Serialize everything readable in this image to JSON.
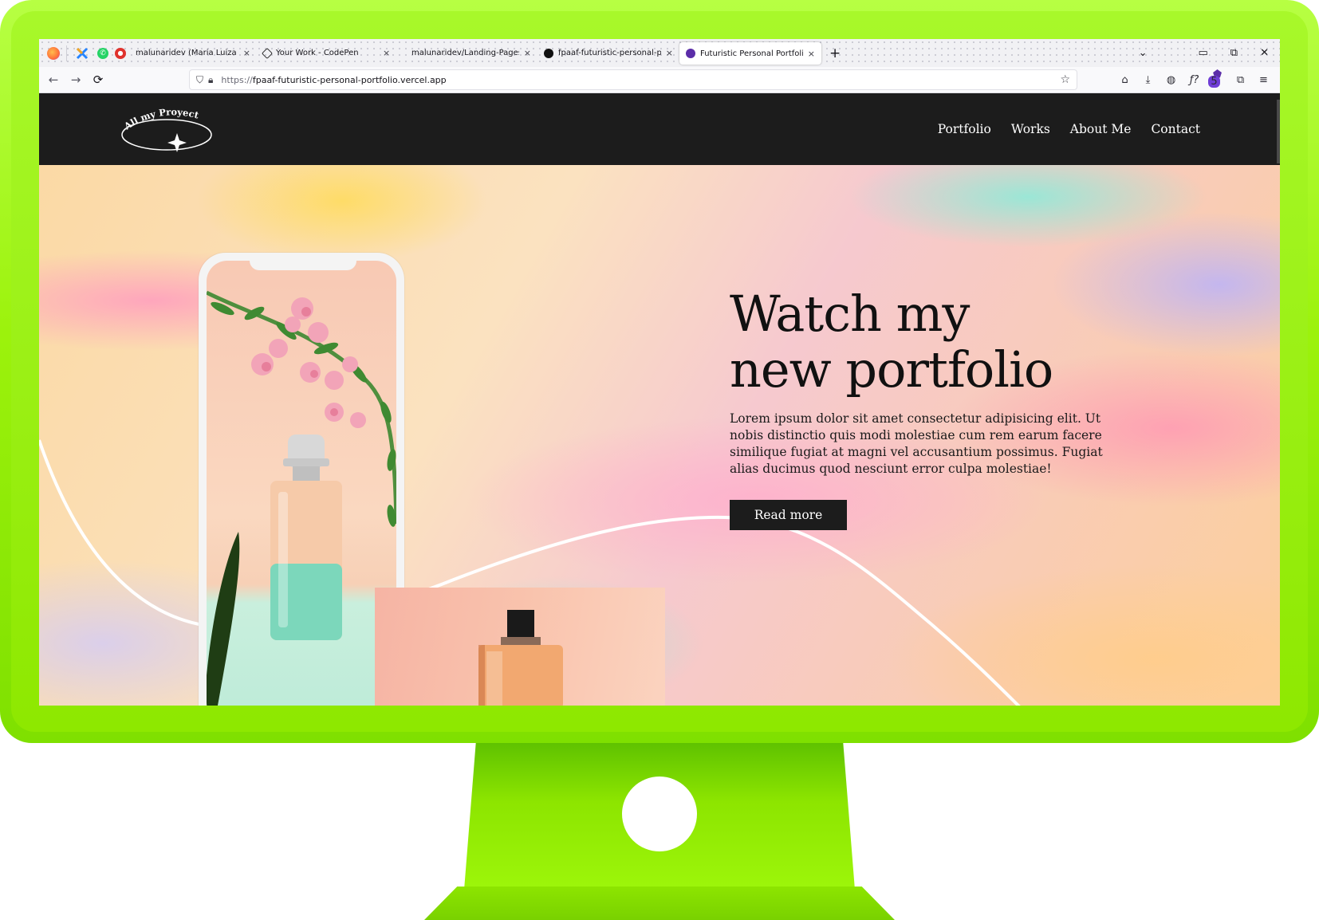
{
  "browser": {
    "pinned_tabs": [
      {
        "icon": "firefox-icon"
      },
      {
        "icon": "confluence-icon"
      },
      {
        "icon": "whatsapp-icon"
      },
      {
        "icon": "notification-icon"
      }
    ],
    "tabs": [
      {
        "title": "malunaridev (Maria Luiza Pinto)",
        "close": "×",
        "active": false,
        "favicon_color": "#f6f6f6"
      },
      {
        "title": "Your Work - CodePen",
        "close": "×",
        "active": false,
        "favicon_color": "#2b2b2b"
      },
      {
        "title": "malunaridev/Landing-Pages-A",
        "close": "×",
        "active": false,
        "favicon_color": "#f6f6f6"
      },
      {
        "title": "fpaaf-futuristic-personal-portfo",
        "close": "×",
        "active": false,
        "favicon_color": "#111111"
      },
      {
        "title": "Futuristic Personal Portfolio",
        "close": "×",
        "active": true,
        "favicon_color": "#5b2da8"
      }
    ],
    "new_tab": "+",
    "tab_list": "⌄",
    "window_controls": {
      "minimize": "▭",
      "restore": "⧉",
      "close": "✕"
    },
    "nav": {
      "back": "←",
      "forward": "→",
      "reload": "⟳"
    },
    "url_prefix": "https://",
    "url": "fpaaf-futuristic-personal-portfolio.vercel.app",
    "bookmark": "☆",
    "toolbar": {
      "home": "⌂",
      "downloads": "⤓",
      "account": "◍",
      "fx": "ƒ?",
      "extension_badge": "5",
      "extensions": "⧉",
      "menu": "≡"
    }
  },
  "site": {
    "logo_text": "All my Proyects",
    "menu": [
      "Portfolio",
      "Works",
      "About Me",
      "Contact"
    ],
    "hero": {
      "title_line1": "Watch my",
      "title_line2": "new portfolio",
      "text": "Lorem ipsum dolor sit amet consectetur adipisicing elit. Ut nobis distinctio quis modi molestiae cum rem earum facere similique fugiat at magni vel accusantium possimus. Fugiat alias ducimus quod nesciunt error culpa molestiae!",
      "button": "Read more"
    }
  },
  "colors": {
    "monitor_frame": "#9cf20c",
    "header_bg": "#1c1c1c",
    "button_bg": "#1c1c1c",
    "text_dark": "#111111"
  }
}
